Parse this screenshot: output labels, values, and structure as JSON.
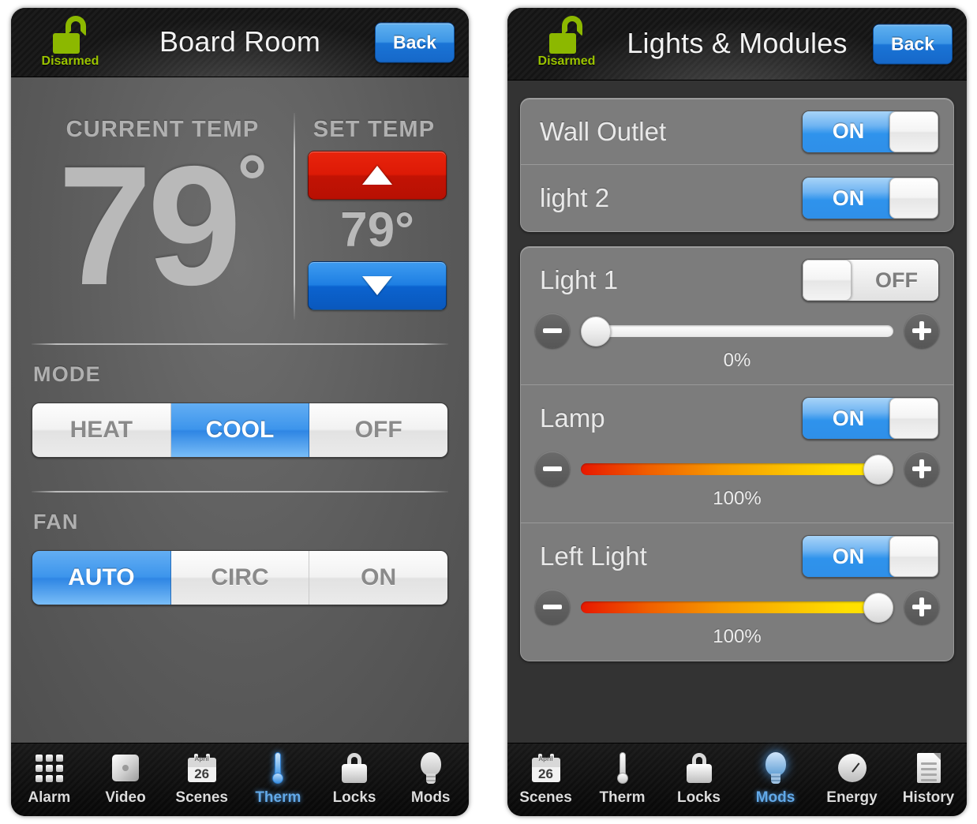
{
  "left_phone": {
    "status": {
      "label": "Disarmed",
      "icon": "unlocked-padlock-icon",
      "color": "#8cb800"
    },
    "title": "Board Room",
    "back_label": "Back",
    "thermostat": {
      "current_label": "CURRENT TEMP",
      "set_label": "SET TEMP",
      "current_value": "79",
      "current_degree": "°",
      "set_value": "79°",
      "up_icon": "triangle-up-icon",
      "down_icon": "triangle-down-icon",
      "mode_label": "MODE",
      "mode_options": [
        {
          "label": "HEAT",
          "selected": false
        },
        {
          "label": "COOL",
          "selected": true
        },
        {
          "label": "OFF",
          "selected": false
        }
      ],
      "fan_label": "FAN",
      "fan_options": [
        {
          "label": "AUTO",
          "selected": true
        },
        {
          "label": "CIRC",
          "selected": false
        },
        {
          "label": "ON",
          "selected": false
        }
      ]
    },
    "tabs": [
      {
        "label": "Alarm",
        "icon": "keypad-grid-icon",
        "active": false
      },
      {
        "label": "Video",
        "icon": "camera-icon",
        "active": false
      },
      {
        "label": "Scenes",
        "icon": "calendar-icon",
        "active": false
      },
      {
        "label": "Therm",
        "icon": "thermometer-icon",
        "active": true
      },
      {
        "label": "Locks",
        "icon": "padlock-icon",
        "active": false
      },
      {
        "label": "Mods",
        "icon": "lightbulb-icon",
        "active": false
      }
    ],
    "calendar": {
      "month": "April",
      "day": "26"
    }
  },
  "right_phone": {
    "status": {
      "label": "Disarmed",
      "icon": "unlocked-padlock-icon",
      "color": "#8cb800"
    },
    "title": "Lights & Modules",
    "back_label": "Back",
    "switches": [
      {
        "name": "Wall Outlet",
        "state": "ON"
      },
      {
        "name": "light 2",
        "state": "ON"
      }
    ],
    "dimmers": [
      {
        "name": "Light 1",
        "state": "OFF",
        "percent": "0%",
        "level": 0
      },
      {
        "name": "Lamp",
        "state": "ON",
        "percent": "100%",
        "level": 100
      },
      {
        "name": "Left Light",
        "state": "ON",
        "percent": "100%",
        "level": 100
      }
    ],
    "slider_minus_icon": "minus-icon",
    "slider_plus_icon": "plus-icon",
    "tabs": [
      {
        "label": "Scenes",
        "icon": "calendar-icon",
        "active": false
      },
      {
        "label": "Therm",
        "icon": "thermometer-icon",
        "active": false
      },
      {
        "label": "Locks",
        "icon": "padlock-icon",
        "active": false
      },
      {
        "label": "Mods",
        "icon": "lightbulb-icon",
        "active": true
      },
      {
        "label": "Energy",
        "icon": "gauge-icon",
        "active": false
      },
      {
        "label": "History",
        "icon": "document-icon",
        "active": false
      }
    ],
    "calendar": {
      "month": "April",
      "day": "26"
    }
  },
  "colors": {
    "accent_blue": "#2f93ec",
    "heat_red": "#dd1a06",
    "cool_blue": "#1e7fe3",
    "status_green": "#8cb800",
    "panel_gray": "#7c7c7c",
    "page_dark": "#333333"
  }
}
